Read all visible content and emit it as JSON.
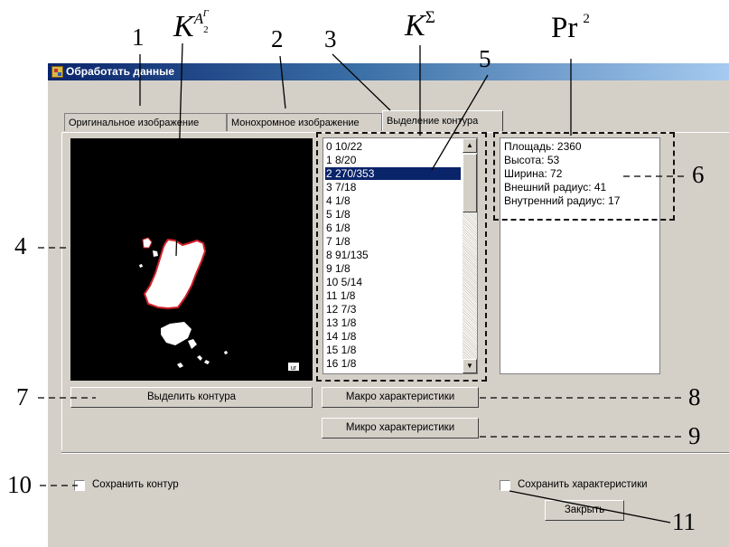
{
  "window": {
    "title": "Обработать данные"
  },
  "tabs": [
    {
      "label": "Оригинальное изображение",
      "active": false
    },
    {
      "label": "Монохромное изображение",
      "active": false
    },
    {
      "label": "Выделение контура",
      "active": true
    }
  ],
  "contour_list": {
    "selected_index": 2,
    "items": [
      "0 10/22",
      "1 8/20",
      "2 270/353",
      "3 7/18",
      "4 1/8",
      "5 1/8",
      "6 1/8",
      "7 1/8",
      "8 91/135",
      "9 1/8",
      "10 5/14",
      "11 1/8",
      "12 7/3",
      "13 1/8",
      "14 1/8",
      "15 1/8",
      "16 1/8"
    ]
  },
  "characteristics": {
    "lines": [
      "Площадь: 2360",
      "Высота: 53",
      "Ширина: 72",
      "Внешний радиус: 41",
      "Внутренний радиус: 17"
    ]
  },
  "image_watermark": "ur",
  "buttons": {
    "select_contours": "Выделить контура",
    "macro": "Макро характеристики",
    "micro": "Микро характеристики",
    "close": "Закрыть"
  },
  "checkboxes": {
    "save_contour": {
      "label": "Сохранить контур",
      "checked": false
    },
    "save_characteristics": {
      "label": "Сохранить характеристики",
      "checked": false
    }
  },
  "annotations": {
    "numbers": [
      "1",
      "2",
      "3",
      "4",
      "5",
      "6",
      "7",
      "8",
      "9",
      "10",
      "11"
    ],
    "k_a2_base": "K",
    "k_a2_sup": "A",
    "k_a2_sup_sub": "2",
    "k_a2_sup_sup": "Г",
    "k_sigma_base": "K",
    "k_sigma_sup": "Σ",
    "pr_base": "Pr",
    "pr_sup": "2"
  },
  "colors": {
    "titlebar": "#0a246a",
    "selection": "#0a246a",
    "face": "#d4d0c8",
    "contour": "#d0202a"
  }
}
